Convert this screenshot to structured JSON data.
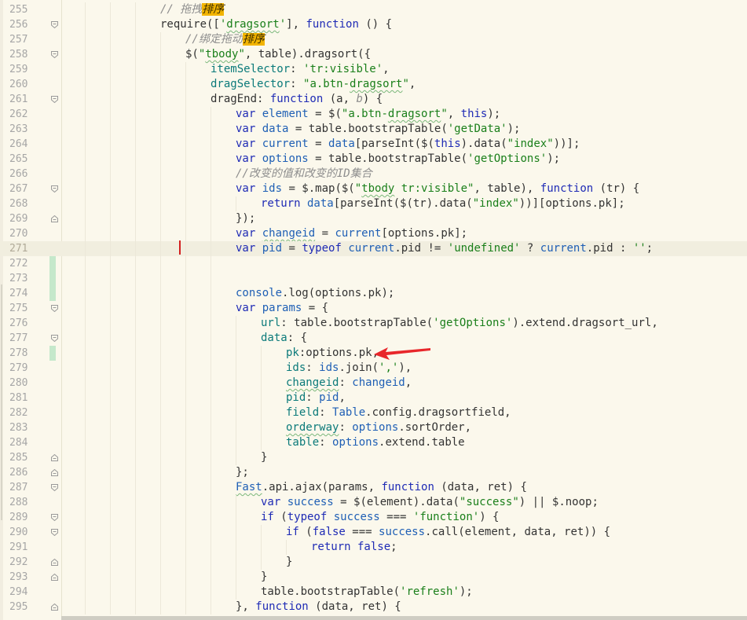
{
  "editor": {
    "first_line": 255,
    "current_line": 271,
    "lines": [
      {
        "n": "255",
        "indent": 4,
        "fold": "",
        "tokens": [
          [
            "cm",
            "// 拖拽"
          ],
          [
            "cm hl",
            "排序"
          ]
        ]
      },
      {
        "n": "256",
        "indent": 4,
        "fold": "open",
        "tokens": [
          [
            "fn",
            "require(["
          ],
          [
            "str",
            "'"
          ],
          [
            "str squig",
            "dragsort"
          ],
          [
            "str",
            "'"
          ],
          [
            "fn",
            "], "
          ],
          [
            "kw",
            "function"
          ],
          [
            "fn",
            " () {"
          ]
        ]
      },
      {
        "n": "257",
        "indent": 5,
        "fold": "",
        "tokens": [
          [
            "cm",
            "//绑定拖动"
          ],
          [
            "cm hl",
            "排序"
          ]
        ]
      },
      {
        "n": "258",
        "indent": 5,
        "fold": "open",
        "tokens": [
          [
            "fn",
            "$("
          ],
          [
            "str",
            "\""
          ],
          [
            "str squig",
            "tbody"
          ],
          [
            "str",
            "\""
          ],
          [
            "fn",
            ", table).dragsort({"
          ]
        ]
      },
      {
        "n": "259",
        "indent": 6,
        "fold": "",
        "tokens": [
          [
            "prop",
            "itemSelector"
          ],
          [
            "fn",
            ": "
          ],
          [
            "str",
            "'tr:visible'"
          ],
          [
            "fn",
            ","
          ]
        ]
      },
      {
        "n": "260",
        "indent": 6,
        "fold": "",
        "tokens": [
          [
            "prop",
            "dragSelector"
          ],
          [
            "fn",
            ": "
          ],
          [
            "str",
            "\"a.btn-"
          ],
          [
            "str squig",
            "dragsort"
          ],
          [
            "str",
            "\""
          ],
          [
            "fn",
            ","
          ]
        ]
      },
      {
        "n": "261",
        "indent": 6,
        "fold": "open",
        "tokens": [
          [
            "fn",
            "dragEnd: "
          ],
          [
            "kw",
            "function"
          ],
          [
            "fn",
            " (a, "
          ],
          [
            "cm",
            "b"
          ],
          [
            "fn",
            ") {"
          ]
        ]
      },
      {
        "n": "262",
        "indent": 7,
        "fold": "",
        "tokens": [
          [
            "kw",
            "var"
          ],
          [
            "vr",
            " element"
          ],
          [
            "fn",
            " = $("
          ],
          [
            "str",
            "\"a.btn-"
          ],
          [
            "str squig",
            "dragsort"
          ],
          [
            "str",
            "\""
          ],
          [
            "fn",
            ", "
          ],
          [
            "kw",
            "this"
          ],
          [
            "fn",
            ");"
          ]
        ]
      },
      {
        "n": "263",
        "indent": 7,
        "fold": "",
        "tokens": [
          [
            "kw",
            "var"
          ],
          [
            "vr",
            " data"
          ],
          [
            "fn",
            " = table.bootstrapTable("
          ],
          [
            "str",
            "'getData'"
          ],
          [
            "fn",
            ");"
          ]
        ]
      },
      {
        "n": "264",
        "indent": 7,
        "fold": "",
        "tokens": [
          [
            "kw",
            "var"
          ],
          [
            "vr",
            " current"
          ],
          [
            "fn",
            " = "
          ],
          [
            "vr",
            "data"
          ],
          [
            "fn",
            "[parseInt($("
          ],
          [
            "kw",
            "this"
          ],
          [
            "fn",
            ").data("
          ],
          [
            "str",
            "\"index\""
          ],
          [
            "fn",
            "))];"
          ]
        ]
      },
      {
        "n": "265",
        "indent": 7,
        "fold": "",
        "tokens": [
          [
            "kw",
            "var"
          ],
          [
            "vr",
            " options"
          ],
          [
            "fn",
            " = table.bootstrapTable("
          ],
          [
            "str",
            "'getOptions'"
          ],
          [
            "fn",
            ");"
          ]
        ]
      },
      {
        "n": "266",
        "indent": 7,
        "fold": "",
        "tokens": [
          [
            "cm",
            "//改变的值和改变的ID集合"
          ]
        ]
      },
      {
        "n": "267",
        "indent": 7,
        "fold": "open",
        "tokens": [
          [
            "kw",
            "var"
          ],
          [
            "vr",
            " ids"
          ],
          [
            "fn",
            " = $.map($("
          ],
          [
            "str",
            "\""
          ],
          [
            "str squig",
            "tbody"
          ],
          [
            "str",
            " tr:visible\""
          ],
          [
            "fn",
            ", table), "
          ],
          [
            "kw",
            "function"
          ],
          [
            "fn",
            " (tr) {"
          ]
        ]
      },
      {
        "n": "268",
        "indent": 8,
        "fold": "",
        "tokens": [
          [
            "kw",
            "return"
          ],
          [
            "vr",
            " data"
          ],
          [
            "fn",
            "[parseInt($(tr).data("
          ],
          [
            "str",
            "\"index\""
          ],
          [
            "fn",
            "))][options.pk];"
          ]
        ]
      },
      {
        "n": "269",
        "indent": 7,
        "fold": "close",
        "tokens": [
          [
            "fn",
            "});"
          ]
        ]
      },
      {
        "n": "270",
        "indent": 7,
        "fold": "",
        "tokens": [
          [
            "kw",
            "var"
          ],
          [
            "fn",
            " "
          ],
          [
            "vr squig",
            "changeid"
          ],
          [
            "fn",
            " = "
          ],
          [
            "vr",
            "current"
          ],
          [
            "fn",
            "[options.pk];"
          ]
        ]
      },
      {
        "n": "271",
        "indent": 7,
        "fold": "",
        "tokens": [
          [
            "kw",
            "var"
          ],
          [
            "vr",
            " pid"
          ],
          [
            "fn",
            " = "
          ],
          [
            "kw",
            "typeof"
          ],
          [
            "vr",
            " current"
          ],
          [
            "fn",
            ".pid != "
          ],
          [
            "str",
            "'undefined'"
          ],
          [
            "fn",
            " ? "
          ],
          [
            "vr",
            "current"
          ],
          [
            "fn",
            ".pid : "
          ],
          [
            "str",
            "''"
          ],
          [
            "fn",
            ";"
          ]
        ]
      },
      {
        "n": "272",
        "indent": 7,
        "fold": "",
        "changed": true,
        "tokens": []
      },
      {
        "n": "273",
        "indent": 7,
        "fold": "",
        "changed": true,
        "tokens": []
      },
      {
        "n": "274",
        "indent": 7,
        "fold": "",
        "changed": true,
        "tokens": [
          [
            "vr",
            "console"
          ],
          [
            "fn",
            ".log(options.pk);"
          ]
        ]
      },
      {
        "n": "275",
        "indent": 7,
        "fold": "open",
        "tokens": [
          [
            "kw",
            "var"
          ],
          [
            "vr",
            " params"
          ],
          [
            "fn",
            " = {"
          ]
        ]
      },
      {
        "n": "276",
        "indent": 8,
        "fold": "",
        "tokens": [
          [
            "prop",
            "url"
          ],
          [
            "fn",
            ": table.bootstrapTable("
          ],
          [
            "str",
            "'getOptions'"
          ],
          [
            "fn",
            ").extend.dragsort_url,"
          ]
        ]
      },
      {
        "n": "277",
        "indent": 8,
        "fold": "open",
        "tokens": [
          [
            "prop",
            "data"
          ],
          [
            "fn",
            ": {"
          ]
        ]
      },
      {
        "n": "278",
        "indent": 9,
        "fold": "",
        "changed": true,
        "tokens": [
          [
            "prop",
            "pk"
          ],
          [
            "fn",
            ":options.pk,"
          ]
        ]
      },
      {
        "n": "279",
        "indent": 9,
        "fold": "",
        "tokens": [
          [
            "prop",
            "ids"
          ],
          [
            "fn",
            ": "
          ],
          [
            "vr",
            "ids"
          ],
          [
            "fn",
            ".join("
          ],
          [
            "str",
            "','"
          ],
          [
            "fn",
            "),"
          ]
        ]
      },
      {
        "n": "280",
        "indent": 9,
        "fold": "",
        "tokens": [
          [
            "prop squig",
            "changeid"
          ],
          [
            "fn",
            ": "
          ],
          [
            "vr",
            "changeid"
          ],
          [
            "fn",
            ","
          ]
        ]
      },
      {
        "n": "281",
        "indent": 9,
        "fold": "",
        "tokens": [
          [
            "prop",
            "pid"
          ],
          [
            "fn",
            ": "
          ],
          [
            "vr",
            "pid"
          ],
          [
            "fn",
            ","
          ]
        ]
      },
      {
        "n": "282",
        "indent": 9,
        "fold": "",
        "tokens": [
          [
            "prop",
            "field"
          ],
          [
            "fn",
            ": "
          ],
          [
            "vr",
            "Table"
          ],
          [
            "fn",
            ".config.dragsortfield,"
          ]
        ]
      },
      {
        "n": "283",
        "indent": 9,
        "fold": "",
        "tokens": [
          [
            "prop squig",
            "orderway"
          ],
          [
            "fn",
            ": "
          ],
          [
            "vr",
            "options"
          ],
          [
            "fn",
            ".sortOrder,"
          ]
        ]
      },
      {
        "n": "284",
        "indent": 9,
        "fold": "",
        "tokens": [
          [
            "prop",
            "table"
          ],
          [
            "fn",
            ": "
          ],
          [
            "vr",
            "options"
          ],
          [
            "fn",
            ".extend.table"
          ]
        ]
      },
      {
        "n": "285",
        "indent": 8,
        "fold": "close",
        "tokens": [
          [
            "fn",
            "}"
          ]
        ]
      },
      {
        "n": "286",
        "indent": 7,
        "fold": "close",
        "tokens": [
          [
            "fn",
            "};"
          ]
        ]
      },
      {
        "n": "287",
        "indent": 7,
        "fold": "open",
        "tokens": [
          [
            "vr squig",
            "Fast"
          ],
          [
            "fn",
            ".api.ajax(params, "
          ],
          [
            "kw",
            "function"
          ],
          [
            "fn",
            " (data, ret) {"
          ]
        ]
      },
      {
        "n": "288",
        "indent": 8,
        "fold": "",
        "tokens": [
          [
            "kw",
            "var"
          ],
          [
            "vr",
            " success"
          ],
          [
            "fn",
            " = $(element).data("
          ],
          [
            "str",
            "\"success\""
          ],
          [
            "fn",
            ") || $.noop;"
          ]
        ]
      },
      {
        "n": "289",
        "indent": 8,
        "fold": "open",
        "tokens": [
          [
            "kw",
            "if"
          ],
          [
            "fn",
            " ("
          ],
          [
            "kw",
            "typeof"
          ],
          [
            "vr",
            " success"
          ],
          [
            "fn",
            " === "
          ],
          [
            "str",
            "'function'"
          ],
          [
            "fn",
            ") {"
          ]
        ]
      },
      {
        "n": "290",
        "indent": 9,
        "fold": "open",
        "tokens": [
          [
            "kw",
            "if"
          ],
          [
            "fn",
            " ("
          ],
          [
            "kw",
            "false"
          ],
          [
            "fn",
            " === "
          ],
          [
            "vr",
            "success"
          ],
          [
            "fn",
            ".call(element, data, ret)) {"
          ]
        ]
      },
      {
        "n": "291",
        "indent": 10,
        "fold": "",
        "tokens": [
          [
            "kw",
            "return false"
          ],
          [
            "fn",
            ";"
          ]
        ]
      },
      {
        "n": "292",
        "indent": 9,
        "fold": "close",
        "tokens": [
          [
            "fn",
            "}"
          ]
        ]
      },
      {
        "n": "293",
        "indent": 8,
        "fold": "close",
        "tokens": [
          [
            "fn",
            "}"
          ]
        ]
      },
      {
        "n": "294",
        "indent": 8,
        "fold": "",
        "tokens": [
          [
            "fn",
            "table.bootstrapTable("
          ],
          [
            "str",
            "'refresh'"
          ],
          [
            "fn",
            ");"
          ]
        ]
      },
      {
        "n": "295",
        "indent": 7,
        "fold": "close",
        "tokens": [
          [
            "fn",
            "}, "
          ],
          [
            "kw",
            "function"
          ],
          [
            "fn",
            " (data, ret) {"
          ]
        ]
      }
    ]
  },
  "colors": {
    "background": "#fbf8ec",
    "current_line": "#f1eedf",
    "keyword": "#1f2bb5",
    "string": "#1a7f1a",
    "comment": "#8d8d8d",
    "highlight": "#f2b400",
    "changed_marker": "#c5e8cb",
    "caret": "#d21f1f",
    "annotation_arrow": "#e8272b"
  },
  "icons": {
    "fold_open": "fold-open-icon",
    "fold_close": "fold-close-icon",
    "annotation": "red-arrow-icon"
  }
}
